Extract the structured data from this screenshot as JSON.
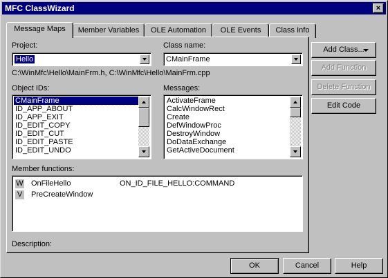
{
  "window": {
    "title": "MFC ClassWizard",
    "close_glyph": "×"
  },
  "tabs": [
    {
      "label": "Message Maps",
      "active": true
    },
    {
      "label": "Member Variables",
      "active": false
    },
    {
      "label": "OLE Automation",
      "active": false
    },
    {
      "label": "OLE Events",
      "active": false
    },
    {
      "label": "Class Info",
      "active": false
    }
  ],
  "project": {
    "label": "Project:",
    "value": "Hello"
  },
  "class_name": {
    "label": "Class name:",
    "value": "CMainFrame"
  },
  "file_path": "C:\\WinMfc\\Hello\\MainFrm.h, C:\\WinMfc\\Hello\\MainFrm.cpp",
  "object_ids": {
    "label": "Object IDs:",
    "items": [
      "CMainFrame",
      "ID_APP_ABOUT",
      "ID_APP_EXIT",
      "ID_EDIT_COPY",
      "ID_EDIT_CUT",
      "ID_EDIT_PASTE",
      "ID_EDIT_UNDO"
    ]
  },
  "messages": {
    "label": "Messages:",
    "items": [
      "ActivateFrame",
      "CalcWindowRect",
      "Create",
      "DefWindowProc",
      "DestroyWindow",
      "DoDataExchange",
      "GetActiveDocument"
    ]
  },
  "member_functions": {
    "label": "Member functions:",
    "rows": [
      {
        "badge": "W",
        "name": "OnFileHello",
        "mapping": "ON_ID_FILE_HELLO:COMMAND"
      },
      {
        "badge": "V",
        "name": "PreCreateWindow",
        "mapping": ""
      }
    ]
  },
  "description_label": "Description:",
  "side_buttons": {
    "add_class": "Add Class...",
    "add_function": "Add Function",
    "delete_function": "Delete Function",
    "edit_code": "Edit Code"
  },
  "bottom_buttons": {
    "ok": "OK",
    "cancel": "Cancel",
    "help": "Help"
  }
}
